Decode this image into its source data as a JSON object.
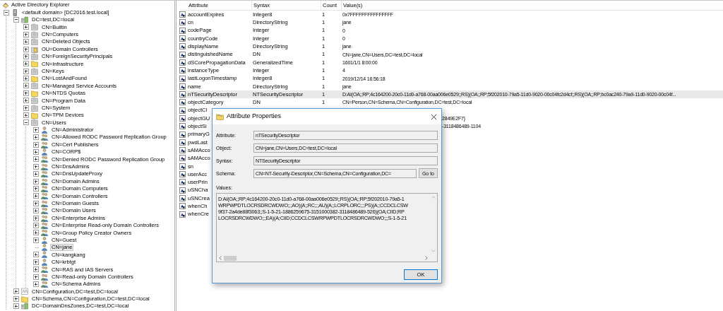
{
  "tree": {
    "title": "Active Directory Explorer",
    "children": [
      {
        "label": "<default domain> [DC2016.test.local]",
        "kind": "server",
        "expanded": true,
        "selected": false,
        "children": [
          {
            "label": "DC=test,DC=local",
            "kind": "domain",
            "expanded": true,
            "selected": false,
            "children": [
              {
                "label": "CN=Builtin",
                "kind": "container",
                "expanded": false,
                "selected": false
              },
              {
                "label": "CN=Computers",
                "kind": "container",
                "expanded": false,
                "selected": false
              },
              {
                "label": "CN=Deleted Objects",
                "kind": "container",
                "expanded": false,
                "selected": false
              },
              {
                "label": "OU=Domain Controllers",
                "kind": "ou",
                "expanded": false,
                "selected": false
              },
              {
                "label": "CN=ForeignSecurityPrincipals",
                "kind": "container",
                "expanded": false,
                "selected": false
              },
              {
                "label": "CN=Infrastructure",
                "kind": "folder",
                "expanded": false,
                "selected": false
              },
              {
                "label": "CN=Keys",
                "kind": "container",
                "expanded": false,
                "selected": false
              },
              {
                "label": "CN=LostAndFound",
                "kind": "folder",
                "expanded": false,
                "selected": false
              },
              {
                "label": "CN=Managed Service Accounts",
                "kind": "container",
                "expanded": false,
                "selected": false
              },
              {
                "label": "CN=NTDS Quotas",
                "kind": "folder",
                "expanded": false,
                "selected": false
              },
              {
                "label": "CN=Program Data",
                "kind": "container",
                "expanded": false,
                "selected": false
              },
              {
                "label": "CN=System",
                "kind": "container",
                "expanded": false,
                "selected": false
              },
              {
                "label": "CN=TPM Devices",
                "kind": "folder",
                "expanded": false,
                "selected": false
              },
              {
                "label": "CN=Users",
                "kind": "container",
                "expanded": true,
                "selected": false,
                "children": [
                  {
                    "label": "CN=Administrator",
                    "kind": "user",
                    "expanded": false,
                    "selected": false
                  },
                  {
                    "label": "CN=Allowed RODC Password Replication Group",
                    "kind": "group",
                    "expanded": false,
                    "selected": false
                  },
                  {
                    "label": "CN=Cert Publishers",
                    "kind": "group",
                    "expanded": false,
                    "selected": false
                  },
                  {
                    "label": "CN=CORP$",
                    "kind": "user",
                    "expanded": false,
                    "selected": false
                  },
                  {
                    "label": "CN=Denied RODC Password Replication Group",
                    "kind": "group",
                    "expanded": false,
                    "selected": false
                  },
                  {
                    "label": "CN=DnsAdmins",
                    "kind": "group",
                    "expanded": false,
                    "selected": false
                  },
                  {
                    "label": "CN=DnsUpdateProxy",
                    "kind": "group",
                    "expanded": false,
                    "selected": false
                  },
                  {
                    "label": "CN=Domain Admins",
                    "kind": "group",
                    "expanded": false,
                    "selected": false
                  },
                  {
                    "label": "CN=Domain Computers",
                    "kind": "group",
                    "expanded": false,
                    "selected": false
                  },
                  {
                    "label": "CN=Domain Controllers",
                    "kind": "group",
                    "expanded": false,
                    "selected": false
                  },
                  {
                    "label": "CN=Domain Guests",
                    "kind": "group",
                    "expanded": false,
                    "selected": false
                  },
                  {
                    "label": "CN=Domain Users",
                    "kind": "group",
                    "expanded": false,
                    "selected": false
                  },
                  {
                    "label": "CN=Enterprise Admins",
                    "kind": "group",
                    "expanded": false,
                    "selected": false
                  },
                  {
                    "label": "CN=Enterprise Read-only Domain Controllers",
                    "kind": "group",
                    "expanded": false,
                    "selected": false
                  },
                  {
                    "label": "CN=Group Policy Creator Owners",
                    "kind": "group",
                    "expanded": false,
                    "selected": false
                  },
                  {
                    "label": "CN=Guest",
                    "kind": "user",
                    "expanded": false,
                    "selected": false
                  },
                  {
                    "label": "CN=jane",
                    "kind": "user",
                    "selected": true
                  },
                  {
                    "label": "CN=kangkang",
                    "kind": "user",
                    "expanded": false,
                    "selected": false
                  },
                  {
                    "label": "CN=krbtgt",
                    "kind": "user",
                    "expanded": false,
                    "selected": false
                  },
                  {
                    "label": "CN=RAS and IAS Servers",
                    "kind": "group",
                    "expanded": false,
                    "selected": false
                  },
                  {
                    "label": "CN=Read-only Domain Controllers",
                    "kind": "group",
                    "expanded": false,
                    "selected": false
                  },
                  {
                    "label": "CN=Schema Admins",
                    "kind": "group",
                    "expanded": false,
                    "selected": false
                  }
                ]
              }
            ]
          },
          {
            "label": "CN=Configuration,DC=test,DC=local",
            "kind": "config",
            "expanded": false,
            "selected": false
          },
          {
            "label": "CN=Schema,CN=Configuration,DC=test,DC=local",
            "kind": "folder",
            "expanded": false,
            "selected": false
          },
          {
            "label": "DC=DomainDnsZones,DC=test,DC=local",
            "kind": "domain",
            "expanded": false,
            "selected": false
          }
        ]
      }
    ]
  },
  "table": {
    "columns": [
      "Attribute",
      "Syntax",
      "Count",
      "Value(s)"
    ],
    "rows": [
      {
        "attribute": "accountExpires",
        "syntax": "Integer8",
        "count": "1",
        "value": "0x7FFFFFFFFFFFFFFF",
        "selected": false
      },
      {
        "attribute": "cn",
        "syntax": "DirectoryString",
        "count": "1",
        "value": "jane",
        "selected": false
      },
      {
        "attribute": "codePage",
        "syntax": "Integer",
        "count": "1",
        "value": "0",
        "selected": false
      },
      {
        "attribute": "countryCode",
        "syntax": "Integer",
        "count": "1",
        "value": "0",
        "selected": false
      },
      {
        "attribute": "displayName",
        "syntax": "DirectoryString",
        "count": "1",
        "value": "jane",
        "selected": false
      },
      {
        "attribute": "distinguishedName",
        "syntax": "DN",
        "count": "1",
        "value": "CN=jane,CN=Users,DC=test,DC=local",
        "selected": false
      },
      {
        "attribute": "dSCorePropagationData",
        "syntax": "GeneralizedTime",
        "count": "1",
        "value": "1601/1/1 8:00:00",
        "selected": false
      },
      {
        "attribute": "instanceType",
        "syntax": "Integer",
        "count": "1",
        "value": "4",
        "selected": false
      },
      {
        "attribute": "lastLogonTimestamp",
        "syntax": "Integer8",
        "count": "1",
        "value": "2019/12/14 16:56:18",
        "selected": false
      },
      {
        "attribute": "name",
        "syntax": "DirectoryString",
        "count": "1",
        "value": "jane",
        "selected": false
      },
      {
        "attribute": "nTSecurityDescriptor",
        "syntax": "NTSecurityDescriptor",
        "count": "1",
        "value": "D:AI(OA;;RP;4c164200-20c0-11d0-a768-00aa006e0529;;RS)(OA;;RP;5f202010-79a5-11d0-9020-00c04fc2d4cf;;RS)(OA;;RP;bc0ac240-79a9-11d0-9020-00c04f...",
        "selected": true
      },
      {
        "attribute": "objectCategory",
        "syntax": "DN",
        "count": "1",
        "value": "CN=Person,CN=Schema,CN=Configuration,DC=test,DC=local",
        "selected": false
      }
    ],
    "rows_behind_dialog": [
      {
        "attribute": "objectCl"
      },
      {
        "attribute": "objectGU",
        "value_tail": "2849E2F7}"
      },
      {
        "attribute": "objectSi",
        "value_tail": "-3118486489-1104"
      },
      {
        "attribute": "primaryG"
      },
      {
        "attribute": "pwdLast"
      },
      {
        "attribute": "sAMAcco"
      },
      {
        "attribute": "sAMAcco"
      },
      {
        "attribute": "sn"
      },
      {
        "attribute": "userAcc"
      },
      {
        "attribute": "userPrin"
      },
      {
        "attribute": "uSNCha"
      },
      {
        "attribute": "uSNCrea"
      },
      {
        "attribute": "whenCh"
      },
      {
        "attribute": "whenCre"
      }
    ]
  },
  "dialog": {
    "title": "Attribute Properties",
    "fields": [
      {
        "label": "Attribute:",
        "value": "nTSecurityDescriptor"
      },
      {
        "label": "Object:",
        "value": "CN=jane,CN=Users,DC=test,DC=local"
      },
      {
        "label": "Syntax:",
        "value": "NTSecurityDescriptor"
      },
      {
        "label": "Schema:",
        "value": "CN=NT-Security-Descriptor,CN=Schema,CN=Configuration,DC=",
        "button": "Go to"
      }
    ],
    "values_label": "Values:",
    "value_lines": [
      "D:AI(OA;;RP;4c164200-20c0-11d0-a768-00aa006e0529;;RS)(OA;;RP;5f202010-79a5-1",
      "WRPWPDTLOCRSDRCWDWO;;;AO)(A;;RC;;;AU)(A;;LCRPLORC;;;PS)(A;;CCDCLCSW",
      "9f37-2a4de88f3063;;S-1-5-21-1886259675-3151000382-3118486489-526)(OA;CIID;RP",
      "LOCRSDRCWDWO;;;EA)(A;CIID;CCDCLCSWRPWPDTLOCRSDRCWDWO;;;S-1-5-21"
    ],
    "ok": "OK"
  }
}
